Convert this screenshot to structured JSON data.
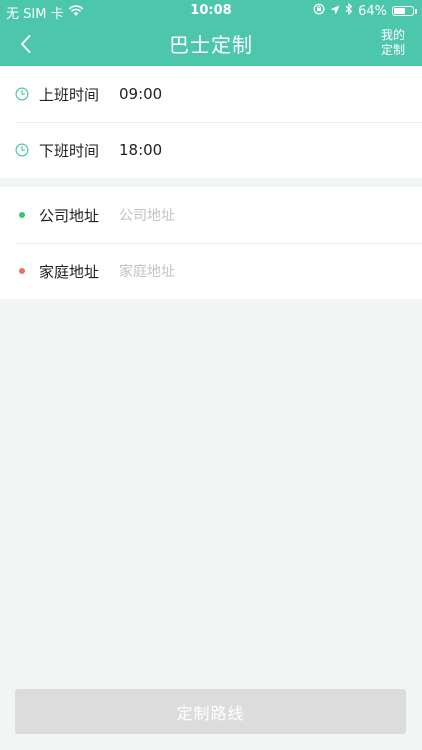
{
  "status_bar": {
    "carrier": "无 SIM 卡",
    "time": "10:08",
    "battery_percent": "64%",
    "battery_level": 0.64,
    "icons": [
      "wifi-icon",
      "lock-rotation-icon",
      "location-arrow-icon",
      "bluetooth-icon",
      "battery-icon"
    ]
  },
  "nav": {
    "back_icon": "chevron-left-icon",
    "title": "巴士定制",
    "my_custom_line1": "我的",
    "my_custom_line2": "定制"
  },
  "time_section": {
    "rows": [
      {
        "icon": "clock-icon",
        "label": "上班时间",
        "value": "09:00"
      },
      {
        "icon": "clock-icon",
        "label": "下班时间",
        "value": "18:00"
      }
    ]
  },
  "address_section": {
    "rows": [
      {
        "icon": "green-dot-icon",
        "label": "公司地址",
        "placeholder": "公司地址"
      },
      {
        "icon": "red-dot-icon",
        "label": "家庭地址",
        "placeholder": "家庭地址"
      }
    ]
  },
  "submit_button": {
    "label": "定制路线",
    "enabled": false
  },
  "colors": {
    "header": "#4dc7ac",
    "background": "#f1f6f5",
    "clock_icon": "#4dc7ac",
    "company_dot": "#3cc46a",
    "home_dot": "#e07468",
    "disabled_button": "#dcdcdc",
    "placeholder_text": "#c2c2c2"
  }
}
